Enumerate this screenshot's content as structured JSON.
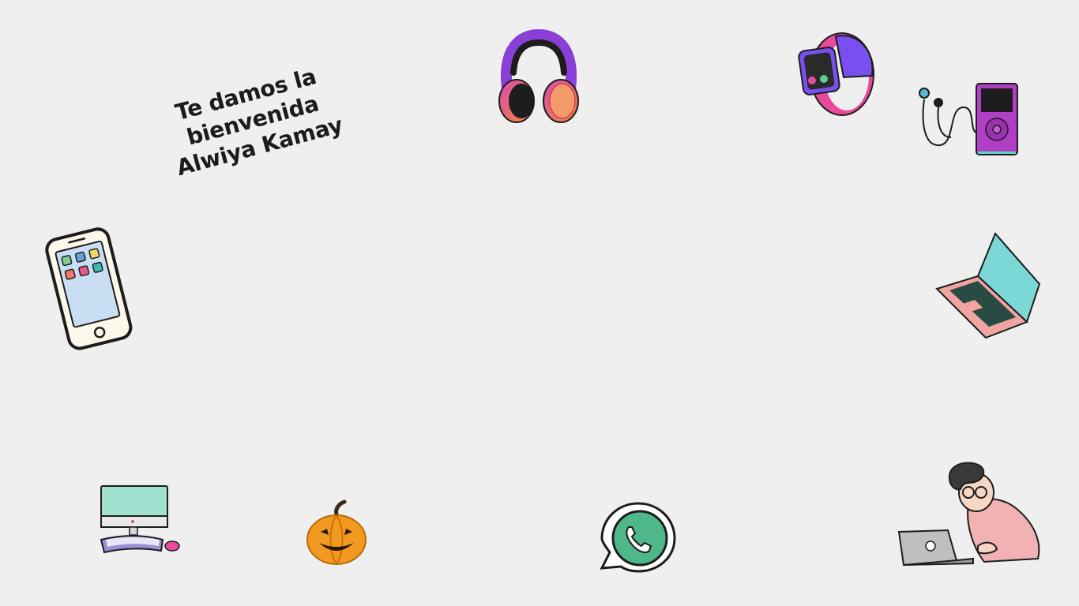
{
  "greeting": {
    "line1": "Te damos la bienvenida",
    "line2": "Alwiya Kamay"
  },
  "stickers": [
    {
      "name": "headphones-icon"
    },
    {
      "name": "smartwatch-icon"
    },
    {
      "name": "mp3-player-icon"
    },
    {
      "name": "smartphone-icon"
    },
    {
      "name": "laptop-icon"
    },
    {
      "name": "desktop-computer-icon"
    },
    {
      "name": "pumpkin-icon"
    },
    {
      "name": "whatsapp-icon"
    },
    {
      "name": "person-with-laptop-icon"
    }
  ],
  "colors": {
    "background": "#efefef",
    "text": "#1b1b1b",
    "accent_pink": "#e84a9c",
    "accent_purple": "#7a4ff0",
    "whatsapp_green": "#4fb88a"
  }
}
